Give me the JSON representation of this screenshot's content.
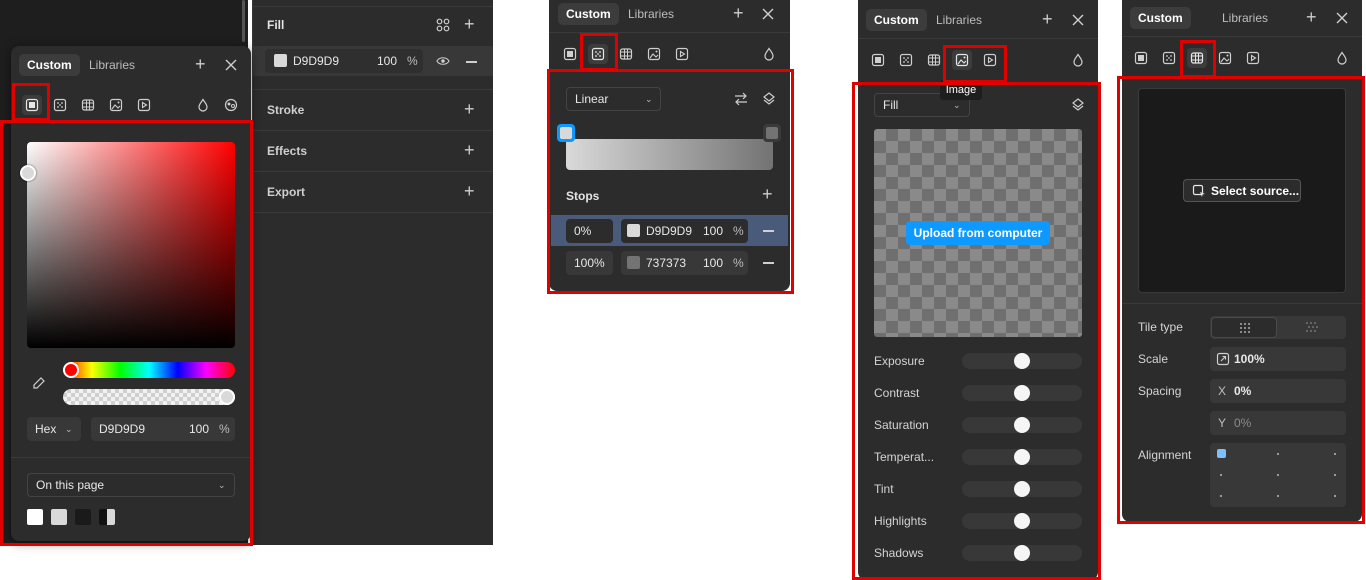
{
  "colors": {
    "highlight": "#e00000",
    "accent": "#0d99ff",
    "panel": "#2c2c2c"
  },
  "panel1": {
    "tabs": {
      "custom": "Custom",
      "libraries": "Libraries"
    },
    "color_mode": "Hex",
    "hex_value": "D9D9D9",
    "opacity": "100",
    "percent": "%",
    "page_select": "On this page",
    "icons": [
      "solid-fill-icon",
      "gradient-icon",
      "pattern-icon",
      "image-icon",
      "video-icon",
      "blend-icon",
      "library-icon"
    ]
  },
  "properties": {
    "fill_label": "Fill",
    "fill_hex": "D9D9D9",
    "fill_opacity": "100",
    "percent": "%",
    "stroke_label": "Stroke",
    "effects_label": "Effects",
    "export_label": "Export"
  },
  "panel2": {
    "tabs": {
      "custom": "Custom",
      "libraries": "Libraries"
    },
    "gradient_type": "Linear",
    "stops_label": "Stops",
    "stops": [
      {
        "position": "0%",
        "hex": "D9D9D9",
        "opacity": "100",
        "percent": "%",
        "color": "#d9d9d9"
      },
      {
        "position": "100%",
        "hex": "737373",
        "opacity": "100",
        "percent": "%",
        "color": "#737373"
      }
    ]
  },
  "panel3": {
    "tabs": {
      "custom": "Custom",
      "libraries": "Libraries"
    },
    "tooltip": "Image",
    "fill_mode": "Fill",
    "upload_button": "Upload from computer",
    "adjustments": [
      {
        "label": "Exposure",
        "value": 0.5
      },
      {
        "label": "Contrast",
        "value": 0.5
      },
      {
        "label": "Saturation",
        "value": 0.5
      },
      {
        "label": "Temperat...",
        "value": 0.5
      },
      {
        "label": "Tint",
        "value": 0.5
      },
      {
        "label": "Highlights",
        "value": 0.5
      },
      {
        "label": "Shadows",
        "value": 0.5
      }
    ]
  },
  "panel4": {
    "tabs": {
      "custom": "Custom",
      "libraries": "Libraries"
    },
    "select_source": "Select source...",
    "tile_type_label": "Tile type",
    "scale_label": "Scale",
    "scale_value": "100%",
    "spacing_label": "Spacing",
    "spacing_x_label": "X",
    "spacing_x": "0%",
    "spacing_y_label": "Y",
    "spacing_y": "0%",
    "alignment_label": "Alignment"
  }
}
